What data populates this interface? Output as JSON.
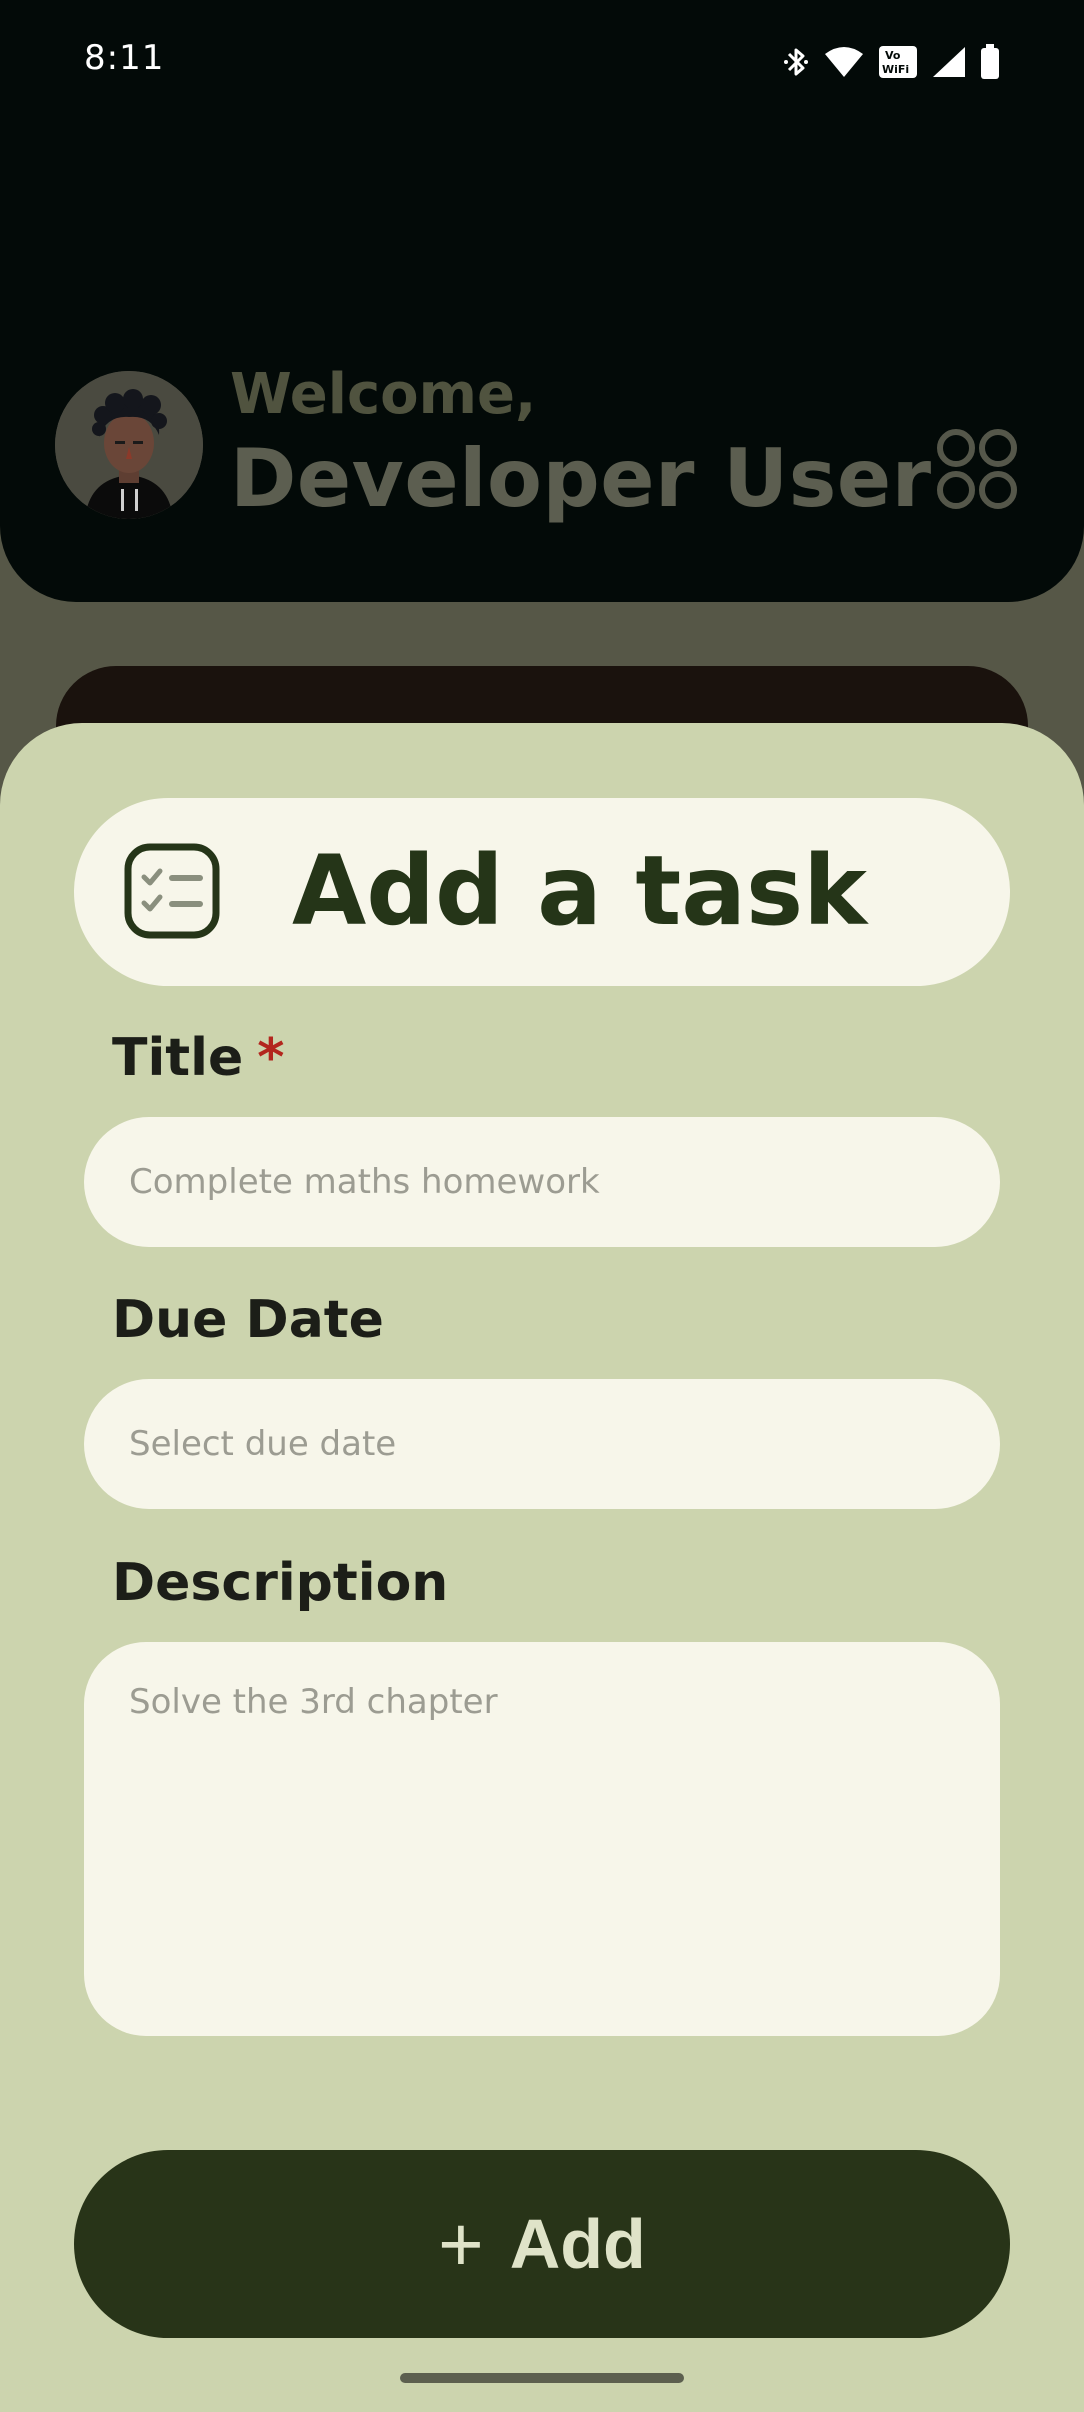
{
  "status_bar": {
    "time": "8:11",
    "icons": [
      "bluetooth-icon",
      "wifi-icon",
      "vowifi-icon",
      "cell-signal-icon",
      "battery-icon"
    ],
    "vowifi_top": "Vo",
    "vowifi_bottom": "WiFi"
  },
  "header": {
    "welcome": "Welcome,",
    "user_name": "Developer User",
    "menu_icon": "grid-menu-icon"
  },
  "sheet": {
    "title": "Add a task",
    "title_icon": "task-list-icon",
    "fields": {
      "title_label": "Title",
      "title_required": "*",
      "title_placeholder": "Complete maths homework",
      "due_label": "Due Date",
      "due_placeholder": "Select due date",
      "desc_label": "Description",
      "desc_placeholder": "Solve the 3rd chapter"
    },
    "add_button": {
      "icon": "+",
      "label": "Add"
    }
  },
  "colors": {
    "sheet_bg": "#ccd4ae",
    "field_bg": "#f7f6ea",
    "primary": "#283418",
    "required": "#b3261e"
  }
}
